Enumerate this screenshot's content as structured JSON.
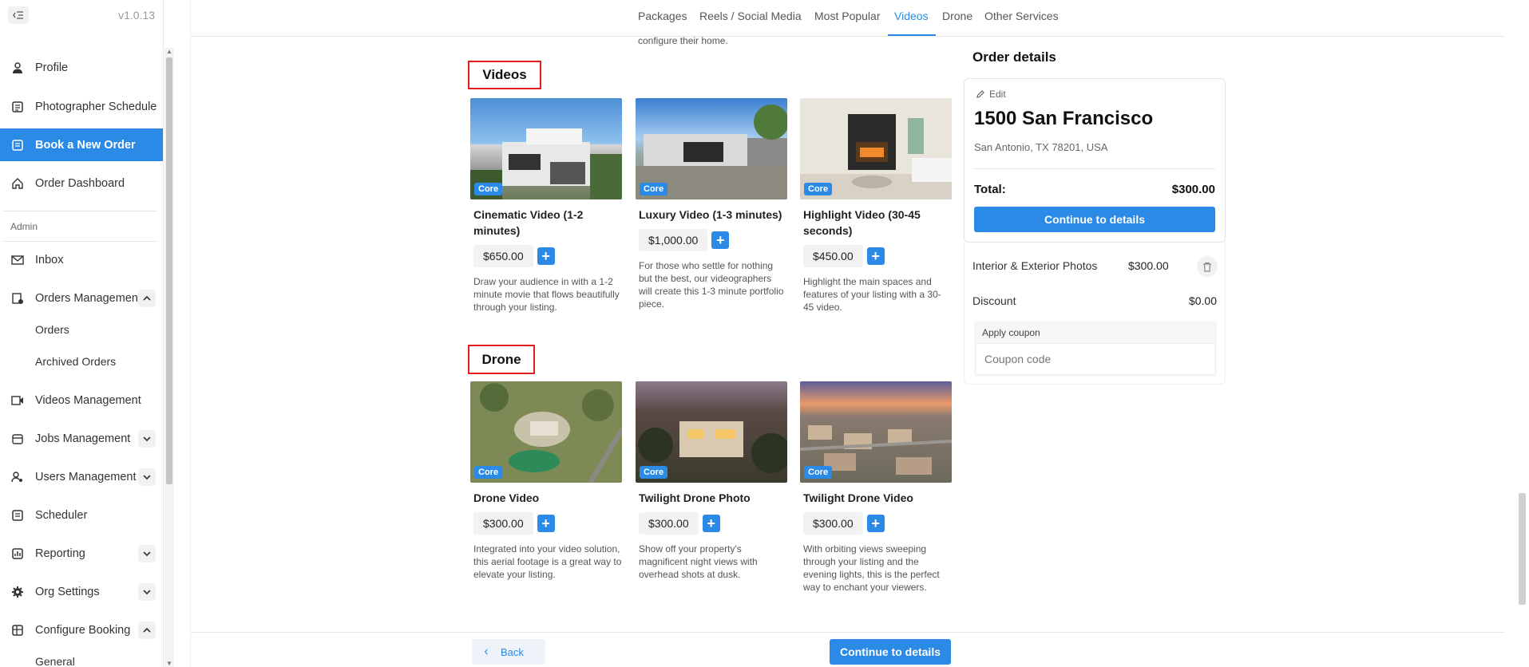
{
  "app": {
    "version": "v1.0.13"
  },
  "sidebar": {
    "items": [
      {
        "label": "Profile",
        "icon": "person-icon"
      },
      {
        "label": "Photographer Schedule",
        "icon": "schedule-icon"
      },
      {
        "label": "Book a New Order",
        "icon": "book-order-icon",
        "active": true
      },
      {
        "label": "Order Dashboard",
        "icon": "home-icon"
      }
    ],
    "admin_label": "Admin",
    "admin_items": [
      {
        "label": "Inbox",
        "icon": "mail-icon"
      },
      {
        "label": "Orders Management",
        "icon": "orders-icon",
        "expanded": true
      },
      {
        "label": "Videos Management",
        "icon": "video-icon"
      },
      {
        "label": "Jobs Management",
        "icon": "jobs-icon"
      },
      {
        "label": "Users Management",
        "icon": "users-icon"
      },
      {
        "label": "Scheduler",
        "icon": "scheduler-icon"
      },
      {
        "label": "Reporting",
        "icon": "reporting-icon"
      },
      {
        "label": "Org Settings",
        "icon": "gear-icon"
      },
      {
        "label": "Configure Booking",
        "icon": "configure-icon",
        "expanded": true
      }
    ],
    "orders_sub": [
      "Orders",
      "Archived Orders"
    ],
    "configure_sub": [
      "General"
    ]
  },
  "topnav": {
    "tabs": [
      "Packages",
      "Reels / Social Media",
      "Most Popular",
      "Videos",
      "Drone",
      "Other Services"
    ],
    "active": "Videos"
  },
  "peek_text": "configure their home.",
  "sections": {
    "videos": {
      "title": "Videos",
      "cards": [
        {
          "title": "Cinematic Video (1-2 minutes)",
          "badge": "Core",
          "price": "$650.00",
          "desc": "Draw your audience in with a 1-2 minute movie that flows beautifully through your listing."
        },
        {
          "title": "Luxury Video (1-3 minutes)",
          "badge": "Core",
          "price": "$1,000.00",
          "desc": "For those who settle for nothing but the best, our videographers will create this 1-3 minute portfolio piece."
        },
        {
          "title": "Highlight Video (30-45 seconds)",
          "badge": "Core",
          "price": "$450.00",
          "desc": "Highlight the main spaces and features of your listing with a 30-45 video."
        }
      ]
    },
    "drone": {
      "title": "Drone",
      "cards": [
        {
          "title": "Drone Video",
          "badge": "Core",
          "price": "$300.00",
          "desc": "Integrated into your video solution, this aerial footage is a great way to elevate your listing."
        },
        {
          "title": "Twilight Drone Photo",
          "badge": "Core",
          "price": "$300.00",
          "desc": "Show off your property's magnificent night views with overhead shots at dusk."
        },
        {
          "title": "Twilight Drone Video",
          "badge": "Core",
          "price": "$300.00",
          "desc": "With orbiting views sweeping through your listing and the evening lights, this is the perfect way to enchant your viewers."
        }
      ]
    }
  },
  "order": {
    "heading": "Order details",
    "edit_label": "Edit",
    "address": "1500 San Francisco",
    "city": "San Antonio, TX 78201, USA",
    "total_label": "Total:",
    "total_value": "$300.00",
    "continue_label": "Continue to details",
    "line_item": {
      "label": "Interior & Exterior Photos",
      "value": "$300.00"
    },
    "discount": {
      "label": "Discount",
      "value": "$0.00"
    },
    "coupon_label": "Apply coupon",
    "coupon_placeholder": "Coupon code"
  },
  "bottom": {
    "back_label": "Back",
    "continue_label": "Continue to details"
  },
  "colors": {
    "accent": "#2a8ae6",
    "highlight_box": "#e01c1c"
  }
}
